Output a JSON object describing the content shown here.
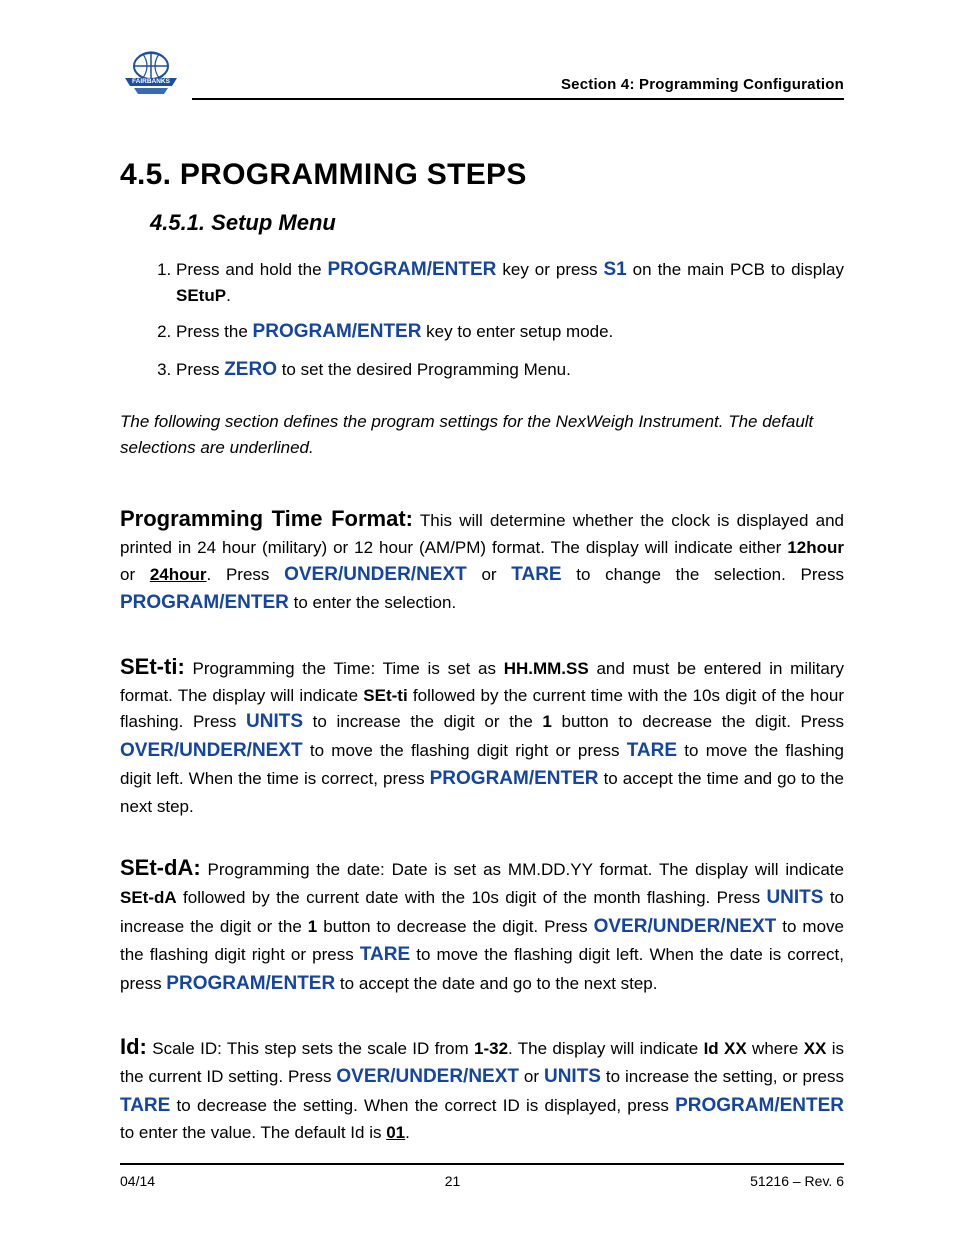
{
  "header": {
    "section_title": "Section 4: Programming Configuration",
    "logo_text_line1": "FAIRBANKS"
  },
  "headings": {
    "main": "4.5.  PROGRAMMING STEPS",
    "sub": "4.5.1.  Setup Menu"
  },
  "steps": {
    "s1_a": "Press and hold the ",
    "s1_key1": "PROGRAM/ENTER",
    "s1_b": " key or press ",
    "s1_key2": "S1",
    "s1_c": " on the main PCB to display ",
    "s1_bold": "SEtuP",
    "s1_d": ".",
    "s2_a": "Press the ",
    "s2_key": "PROGRAM/ENTER",
    "s2_b": " key to enter setup mode.",
    "s3_a": "Press ",
    "s3_key": "ZERO",
    "s3_b": " to set the desired Programming Menu."
  },
  "note": "The following section defines the program settings for the NexWeigh Instrument.  The default selections are underlined.",
  "p_time": {
    "lead": "Programming Time Format:",
    "a": "  This will determine whether the clock is displayed and printed in 24 hour (military) or 12 hour (AM/PM) format.  The display will indicate either ",
    "b1": "12hour",
    "b2": " or ",
    "b3": "24hour",
    "c": ".  Press ",
    "k1": "OVER/UNDER/NEXT",
    "d": " or ",
    "k2": "TARE",
    "e": " to change the selection.  Press ",
    "k3": "PROGRAM/ENTER",
    "f": " to enter the selection."
  },
  "p_setti": {
    "lead": "SEt-ti:",
    "a": "  Programming the Time:  Time is set as ",
    "b1": "HH.MM.SS",
    "b2": " and must be entered in military format.  The display will indicate ",
    "b3": "SEt-ti",
    "c": " followed by the current time with the 10s digit of the hour flashing.  Press ",
    "k1": "UNITS",
    "d": " to increase the digit or the ",
    "b4": "1",
    "e": " button to decrease the digit.  Press ",
    "k2": "OVER/UNDER/NEXT",
    "f": " to move the flashing digit right or press ",
    "k3": "TARE",
    "g": " to move the flashing digit left.  When the time is correct, press ",
    "k4": "PROGRAM/ENTER",
    "h": " to accept the time and go to the next step."
  },
  "p_setda": {
    "lead": "SEt-dA:",
    "a": "  Programming the date:  Date is set as MM.DD.YY format.  The display will indicate ",
    "b1": "SEt-dA",
    "b2": " followed by the current date with the 10s digit of the month flashing.  Press ",
    "k1": "UNITS",
    "c": " to increase the digit or the ",
    "b3": "1",
    "d": " button to decrease the digit.  Press ",
    "k2": "OVER/UNDER/NEXT",
    "e": " to move the flashing digit right or press ",
    "k3": "TARE",
    "f": " to move the flashing digit left.  When the date is correct, press ",
    "k4": "PROGRAM/ENTER",
    "g": " to accept the date and go to the next step."
  },
  "p_id": {
    "lead": "Id:",
    "a": "  Scale ID:  This step sets the scale ID from ",
    "b1": "1-32",
    "b2": ".  The display will indicate ",
    "b3": "Id XX",
    "c": " where ",
    "b4": "XX",
    "d": " is the current ID setting.  Press ",
    "k1": "OVER/UNDER/NEXT",
    "e": " or ",
    "k2": "UNITS",
    "f": " to increase the setting, or press ",
    "k3": "TARE",
    "g": " to decrease the setting.  When the correct ID is displayed, press ",
    "k4": "PROGRAM/ENTER",
    "h": " to enter the value.  The default Id is ",
    "b5": "01",
    "i": "."
  },
  "footer": {
    "left": "04/14",
    "center": "21",
    "right": "51216 – Rev. 6"
  }
}
